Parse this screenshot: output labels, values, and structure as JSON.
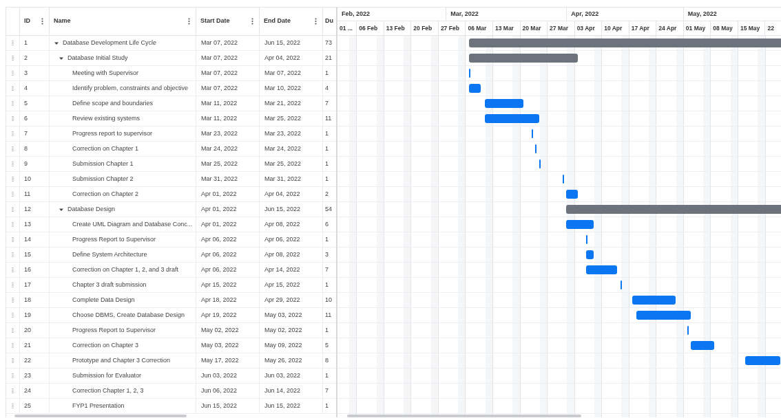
{
  "grid": {
    "columns": [
      {
        "label": "ID",
        "menu": true
      },
      {
        "label": "Name",
        "menu": true
      },
      {
        "label": "Start Date",
        "menu": true
      },
      {
        "label": "End Date",
        "menu": true
      },
      {
        "label": "Du",
        "menu": false
      }
    ],
    "rows": [
      {
        "id": "1",
        "name": "Database Development Life Cycle",
        "start": "Mar 07, 2022",
        "end": "Jun 15, 2022",
        "duration": "73",
        "kind": "summary",
        "expanded": true,
        "children": [
          {
            "id": "2",
            "name": "Database Initial Study",
            "start": "Mar 07, 2022",
            "end": "Apr 04, 2022",
            "duration": "21",
            "kind": "summary",
            "expanded": true,
            "children": [
              {
                "id": "3",
                "name": "Meeting with Supervisor",
                "start": "Mar 07, 2022",
                "end": "Mar 07, 2022",
                "duration": "1",
                "kind": "task"
              },
              {
                "id": "4",
                "name": "Identify problem, constraints and objective",
                "start": "Mar 07, 2022",
                "end": "Mar 10, 2022",
                "duration": "4",
                "kind": "task"
              },
              {
                "id": "5",
                "name": "Define scope and boundaries",
                "start": "Mar 11, 2022",
                "end": "Mar 21, 2022",
                "duration": "7",
                "kind": "task"
              },
              {
                "id": "6",
                "name": "Review existing systems",
                "start": "Mar 11, 2022",
                "end": "Mar 25, 2022",
                "duration": "11",
                "kind": "task"
              },
              {
                "id": "7",
                "name": "Progress report to supervisor",
                "start": "Mar 23, 2022",
                "end": "Mar 23, 2022",
                "duration": "1",
                "kind": "task"
              },
              {
                "id": "8",
                "name": "Correction on Chapter 1",
                "start": "Mar 24, 2022",
                "end": "Mar 24, 2022",
                "duration": "1",
                "kind": "task"
              },
              {
                "id": "9",
                "name": "Submission Chapter 1",
                "start": "Mar 25, 2022",
                "end": "Mar 25, 2022",
                "duration": "1",
                "kind": "task"
              },
              {
                "id": "10",
                "name": "Submission Chapter 2",
                "start": "Mar 31, 2022",
                "end": "Mar 31, 2022",
                "duration": "1",
                "kind": "task"
              },
              {
                "id": "11",
                "name": "Correction on Chapter 2",
                "start": "Apr 01, 2022",
                "end": "Apr 04, 2022",
                "duration": "2",
                "kind": "task"
              }
            ]
          },
          {
            "id": "12",
            "name": "Database Design",
            "start": "Apr 01, 2022",
            "end": "Jun 15, 2022",
            "duration": "54",
            "kind": "summary",
            "expanded": true,
            "children": [
              {
                "id": "13",
                "name": "Create UML Diagram and Database Conc...",
                "start": "Apr 01, 2022",
                "end": "Apr 08, 2022",
                "duration": "6",
                "kind": "task"
              },
              {
                "id": "14",
                "name": "Progress Report to Supervisor",
                "start": "Apr 06, 2022",
                "end": "Apr 06, 2022",
                "duration": "1",
                "kind": "task"
              },
              {
                "id": "15",
                "name": "Define System Architecture",
                "start": "Apr 06, 2022",
                "end": "Apr 08, 2022",
                "duration": "3",
                "kind": "task"
              },
              {
                "id": "16",
                "name": "Correction on Chapter 1, 2, and 3 draft",
                "start": "Apr 06, 2022",
                "end": "Apr 14, 2022",
                "duration": "7",
                "kind": "task"
              },
              {
                "id": "17",
                "name": "Chapter 3 draft submission",
                "start": "Apr 15, 2022",
                "end": "Apr 15, 2022",
                "duration": "1",
                "kind": "task"
              },
              {
                "id": "18",
                "name": "Complete Data Design",
                "start": "Apr 18, 2022",
                "end": "Apr 29, 2022",
                "duration": "10",
                "kind": "task"
              },
              {
                "id": "19",
                "name": "Choose DBMS, Create Database Design",
                "start": "Apr 19, 2022",
                "end": "May 03, 2022",
                "duration": "11",
                "kind": "task"
              },
              {
                "id": "20",
                "name": "Progress Report to Supervisor",
                "start": "May 02, 2022",
                "end": "May 02, 2022",
                "duration": "1",
                "kind": "task"
              },
              {
                "id": "21",
                "name": "Correction on Chapter 3",
                "start": "May 03, 2022",
                "end": "May 09, 2022",
                "duration": "5",
                "kind": "task"
              },
              {
                "id": "22",
                "name": "Prototype and Chapter 3 Correction",
                "start": "May 17, 2022",
                "end": "May 26, 2022",
                "duration": "8",
                "kind": "task"
              },
              {
                "id": "23",
                "name": "Submission for Evaluator",
                "start": "Jun 03, 2022",
                "end": "Jun 03, 2022",
                "duration": "1",
                "kind": "task"
              },
              {
                "id": "24",
                "name": "Correction Chapter 1, 2, 3",
                "start": "Jun 06, 2022",
                "end": "Jun 14, 2022",
                "duration": "7",
                "kind": "task"
              },
              {
                "id": "25",
                "name": "FYP1 Presentation",
                "start": "Jun 15, 2022",
                "end": "Jun 15, 2022",
                "duration": "1",
                "kind": "task"
              }
            ]
          }
        ]
      }
    ]
  },
  "timeline": {
    "months": [
      "Feb, 2022",
      "Mar, 2022",
      "Apr, 2022",
      "May, 2022"
    ],
    "weeks": [
      "01 ...",
      "06 Feb",
      "13 Feb",
      "20 Feb",
      "27 Feb",
      "06 Mar",
      "13 Mar",
      "20 Mar",
      "27 Mar",
      "03 Apr",
      "10 Apr",
      "17 Apr",
      "24 Apr",
      "01 May",
      "08 May",
      "15 May",
      "22"
    ]
  }
}
